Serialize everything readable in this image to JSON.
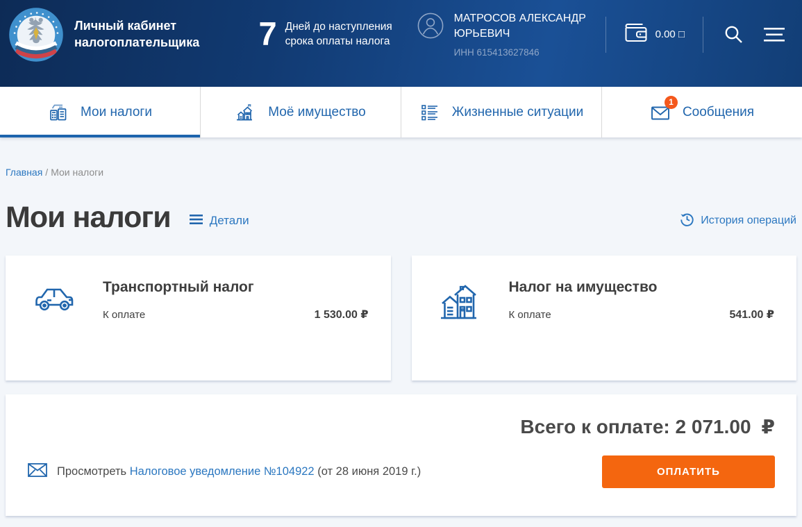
{
  "header": {
    "brand_title": "Личный кабинет налогоплательщика",
    "deadline_days": "7",
    "deadline_text": "Дней до наступления срока оплаты налога",
    "user_name": "МАТРОСОВ АЛЕКСАНДР ЮРЬЕВИЧ",
    "user_inn": "ИНН 615413627846",
    "wallet_balance": "0.00 □"
  },
  "tabs": [
    {
      "label": "Мои налоги",
      "active": true
    },
    {
      "label": "Моё имущество",
      "active": false
    },
    {
      "label": "Жизненные ситуации",
      "active": false
    },
    {
      "label": "Сообщения",
      "active": false,
      "badge": "1"
    }
  ],
  "breadcrumb": {
    "home": "Главная",
    "separator": "/",
    "current": "Мои налоги"
  },
  "page": {
    "title": "Мои налоги",
    "details_link": "Детали",
    "history_link": "История операций"
  },
  "tax_cards": [
    {
      "title": "Транспортный налог",
      "due_label": "К оплате",
      "amount": "1 530.00 ₽"
    },
    {
      "title": "Налог на имущество",
      "due_label": "К оплате",
      "amount": "541.00 ₽"
    }
  ],
  "summary": {
    "total_label": "Всего к оплате: 2 071.00",
    "currency": "₽",
    "view_prefix": "Просмотреть",
    "notice_link": "Налоговое уведомление №104922",
    "notice_suffix": "(от 28 июня 2019 г.)",
    "pay_button": "ОПЛАТИТЬ"
  },
  "icons": {
    "fns_logo": "federal-tax-service-emblem",
    "user_avatar": "person-in-circle",
    "wallet": "wallet",
    "search": "magnifier",
    "menu": "hamburger-lines",
    "tab_taxes": "calculator-and-document",
    "tab_property": "houses",
    "tab_situations": "checklist",
    "tab_messages": "envelope-with-badge",
    "details": "three-lines",
    "history": "clock-with-arrow",
    "transport": "car",
    "estate": "houses",
    "notice": "sealed-envelope"
  },
  "colors": {
    "header_dark": "#0d2b56",
    "header_light": "#1a5096",
    "accent_blue": "#2166ad",
    "link_blue": "#2b77c0",
    "active_tab_underline": "#1d64ad",
    "button_orange": "#f4660f",
    "badge_orange": "#f4581c",
    "page_bg": "#f3f6fa",
    "text_dark": "#3e3e3e",
    "text_grey": "#8c8c8c",
    "inn_grey": "#8fa6c7"
  }
}
